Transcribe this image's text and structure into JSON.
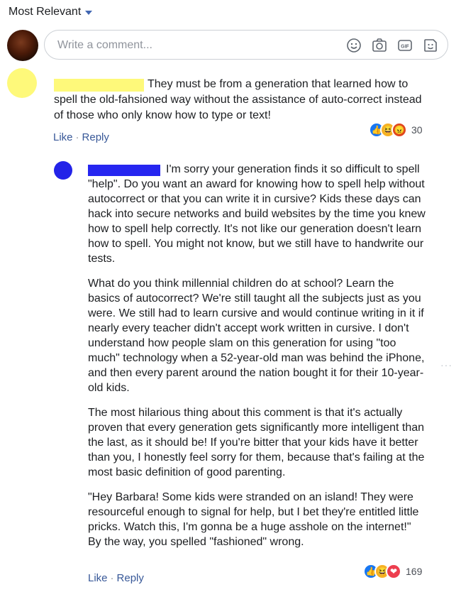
{
  "sort": {
    "label": "Most Relevant"
  },
  "composer": {
    "placeholder": "Write a comment...",
    "icons": [
      "emoji-icon",
      "camera-icon",
      "gif-icon",
      "sticker-icon"
    ]
  },
  "comment": {
    "text": "They must be from a generation that learned how to spell the old-fahsioned way without the assistance of auto-correct instead of those who only know how to type or text!",
    "like_label": "Like",
    "reply_label": "Reply",
    "reactions": {
      "icons": [
        "like",
        "haha",
        "angry"
      ],
      "count": "30"
    }
  },
  "reply": {
    "paragraphs": [
      "I'm sorry your generation finds it so difficult to spell \"help\". Do you want an award for knowing how to spell help without autocorrect or that you can write it in cursive? Kids these days can hack into secure networks and build websites by the time you knew how to spell help correctly. It's not like our generation doesn't learn how to spell. You might not know, but we still have to handwrite our tests.",
      "What do you think millennial children do at school? Learn the basics of autocorrect? We're still taught all the subjects just as you were. We still had to learn cursive and would continue writing in it if nearly every teacher didn't accept work written in cursive. I don't understand how people slam on this generation for using \"too much\" technology when a 52-year-old man was behind the iPhone, and then every parent around the nation bought it for their 10-year-old kids.",
      "The most hilarious thing about this comment is that it's actually proven that every generation gets significantly more intelligent than the last, as it should be! If you're bitter that your kids have it better than you, I honestly feel sorry for them, because that's failing at the most basic definition of good parenting.",
      "\"Hey Barbara! Some kids were stranded on an island! They were resourceful enough to signal for help, but I bet they're entitled little pricks. Watch this, I'm gonna be a huge asshole on the internet!\" By the way, you spelled \"fashioned\" wrong."
    ],
    "like_label": "Like",
    "reply_label": "Reply",
    "reactions": {
      "icons": [
        "like",
        "haha",
        "love"
      ],
      "count": "169"
    },
    "more_label": "···"
  },
  "colors": {
    "link": "#385898",
    "redact_yellow": "#fef97a",
    "redact_blue": "#2626f0",
    "like_blue": "#1877f2"
  }
}
